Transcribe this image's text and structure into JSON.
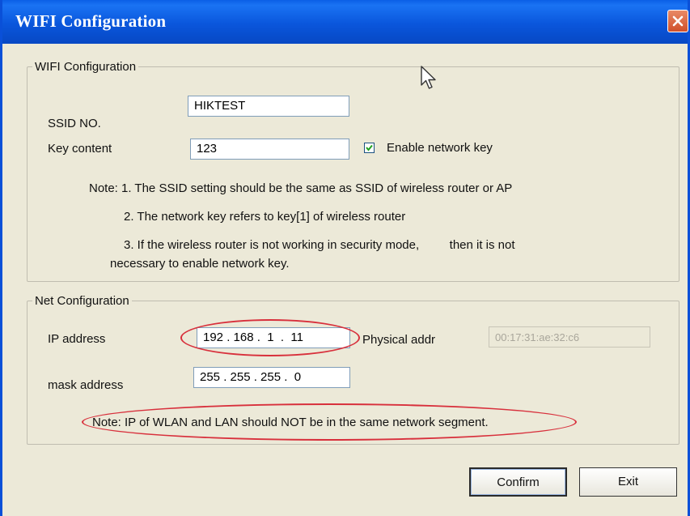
{
  "window": {
    "title": "WIFI Configuration"
  },
  "wifi_group": {
    "legend": "WIFI Configuration",
    "ssid_label": "SSID NO.",
    "ssid_value": "HIKTEST",
    "key_label": "Key content",
    "key_value": "123",
    "enable_key_label": "Enable network key",
    "enable_key_checked": true,
    "notes": [
      "Note: 1. The SSID setting should be the same as SSID of wireless router or AP",
      "2. The network key refers to key[1] of wireless router",
      "3. If the wireless router is not working in security mode,         then it is not",
      "necessary to enable network key."
    ]
  },
  "net_group": {
    "legend": "Net Configuration",
    "ip_label": "IP address",
    "ip_value": "192 . 168 .  1  .  11",
    "physical_label": "Physical addr",
    "physical_value": "00:17:31:ae:32:c6",
    "mask_label": "mask address",
    "mask_value": "255 . 255 . 255 .  0",
    "note": "Note: IP of WLAN and LAN should NOT be in the same network segment."
  },
  "buttons": {
    "confirm": "Confirm",
    "exit": "Exit"
  },
  "colors": {
    "titlebar": "#0a56dc",
    "dialog_bg": "#ece9d8",
    "annotation": "#d8303c"
  },
  "icons": {
    "close": "close-icon",
    "check": "checkmark-icon",
    "cursor": "mouse-pointer-icon"
  }
}
